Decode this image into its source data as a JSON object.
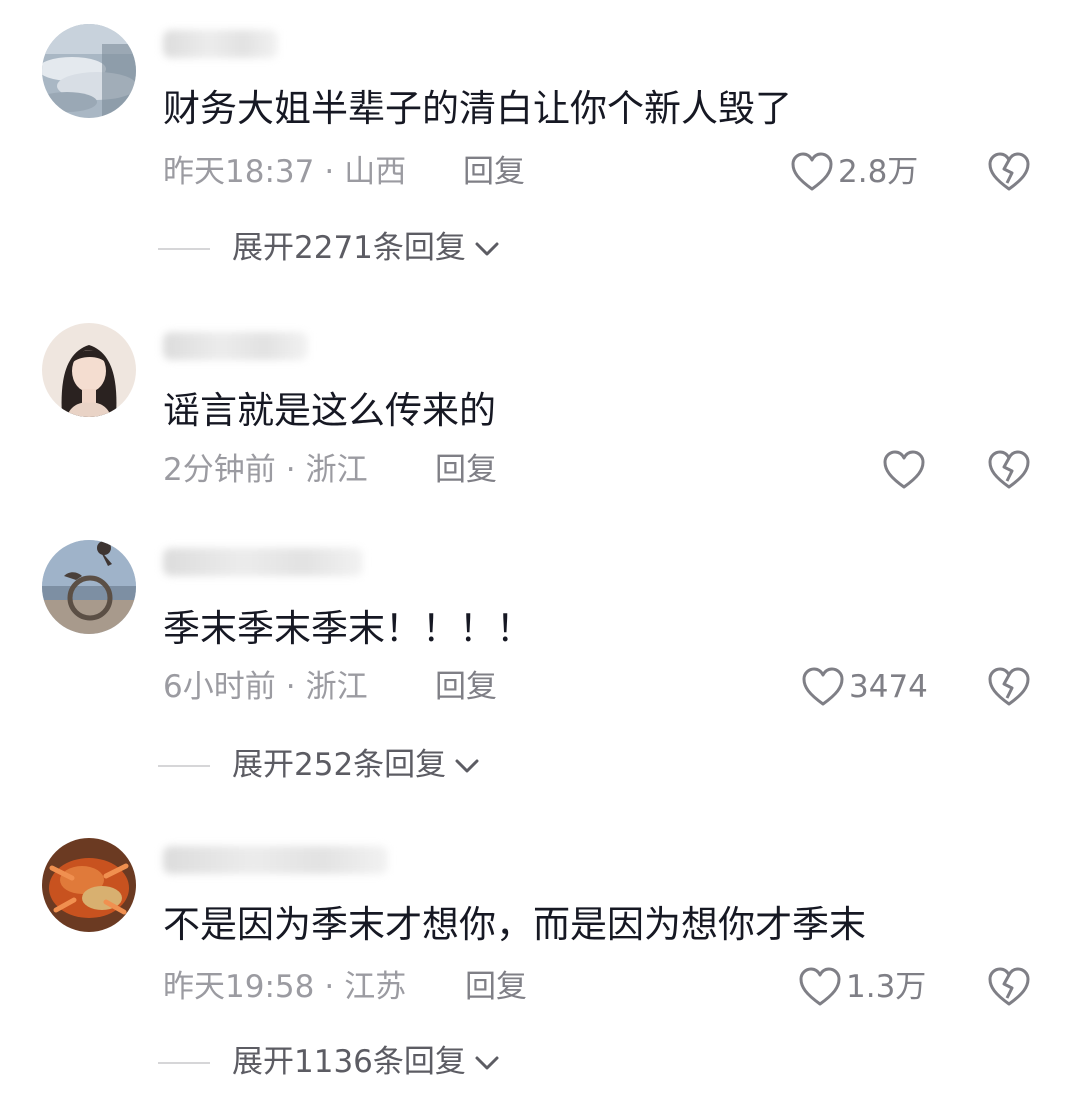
{
  "comments": [
    {
      "avatar_icon": "avatar-sky-clouds",
      "text": "财务大姐半辈子的清白让你个新人毁了",
      "time": "昨天18:37",
      "location": "山西",
      "reply_label": "回复",
      "like_icon": "heart-outline-icon",
      "likes": "2.8万",
      "dislike_icon": "broken-heart-icon",
      "expand_label": "展开2271条回复",
      "expand_icon": "chevron-down-icon"
    },
    {
      "avatar_icon": "avatar-woman-portrait",
      "text": "谣言就是这么传来的",
      "time": "2分钟前",
      "location": "浙江",
      "reply_label": "回复",
      "like_icon": "heart-outline-icon",
      "likes": "",
      "dislike_icon": "broken-heart-icon"
    },
    {
      "avatar_icon": "avatar-bird-seaside",
      "text": "季末季末季末！！！！",
      "time": "6小时前",
      "location": "浙江",
      "reply_label": "回复",
      "like_icon": "heart-outline-icon",
      "likes": "3474",
      "dislike_icon": "broken-heart-icon",
      "expand_label": "展开252条回复",
      "expand_icon": "chevron-down-icon"
    },
    {
      "avatar_icon": "avatar-crab-food",
      "text": "不是因为季末才想你，而是因为想你才季末",
      "time": "昨天19:58",
      "location": "江苏",
      "reply_label": "回复",
      "like_icon": "heart-outline-icon",
      "likes": "1.3万",
      "dislike_icon": "broken-heart-icon",
      "expand_label": "展开1136条回复",
      "expand_icon": "chevron-down-icon"
    }
  ],
  "separator": "·",
  "colors": {
    "text_primary": "#161823",
    "text_meta": "#9b9ba1",
    "text_action": "#7f7f86"
  }
}
